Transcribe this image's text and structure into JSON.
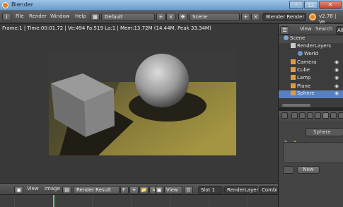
{
  "window": {
    "title": "Blender"
  },
  "infobar": {
    "menus": [
      "File",
      "Render",
      "Window",
      "Help"
    ],
    "screen_layout": "Default",
    "scene": "Scene",
    "render_engine": "Blender Render",
    "version": "v2.78 | Ve"
  },
  "viewport": {
    "stats": "Frame:1 | Time:00:01.72 | Ve:494 Fa:519 La:1 | Mem:13.72M (14.44M, Peak 33.34M)"
  },
  "image_editor": {
    "menus": [
      "View",
      "Image"
    ],
    "image_name": "Render Result",
    "f_label": "F",
    "view_label": "View",
    "slot": "Slot 1",
    "render_layer": "RenderLayer",
    "pass": "Combine"
  },
  "outliner": {
    "header_menus": [
      "View",
      "Search",
      "All"
    ],
    "items": [
      {
        "label": "Scene",
        "icon_color": "#7aa6d8"
      },
      {
        "label": "RenderLayers",
        "icon_color": "#c8c8c8"
      },
      {
        "label": "World",
        "icon_color": "#6f93c9"
      },
      {
        "label": "Camera",
        "icon_color": "#e39a3b"
      },
      {
        "label": "Cube",
        "icon_color": "#e39a3b"
      },
      {
        "label": "Lamp",
        "icon_color": "#e39a3b"
      },
      {
        "label": "Plane",
        "icon_color": "#e39a3b"
      },
      {
        "label": "Sphere",
        "icon_color": "#e39a3b"
      }
    ]
  },
  "properties": {
    "context_object": "Sphere",
    "new_button": "New"
  },
  "colors": {
    "accent_orange": "#e8801c",
    "selection_blue": "#5680c2",
    "timeline_cursor": "#5fd35f",
    "floor": "#8a7d3a"
  }
}
